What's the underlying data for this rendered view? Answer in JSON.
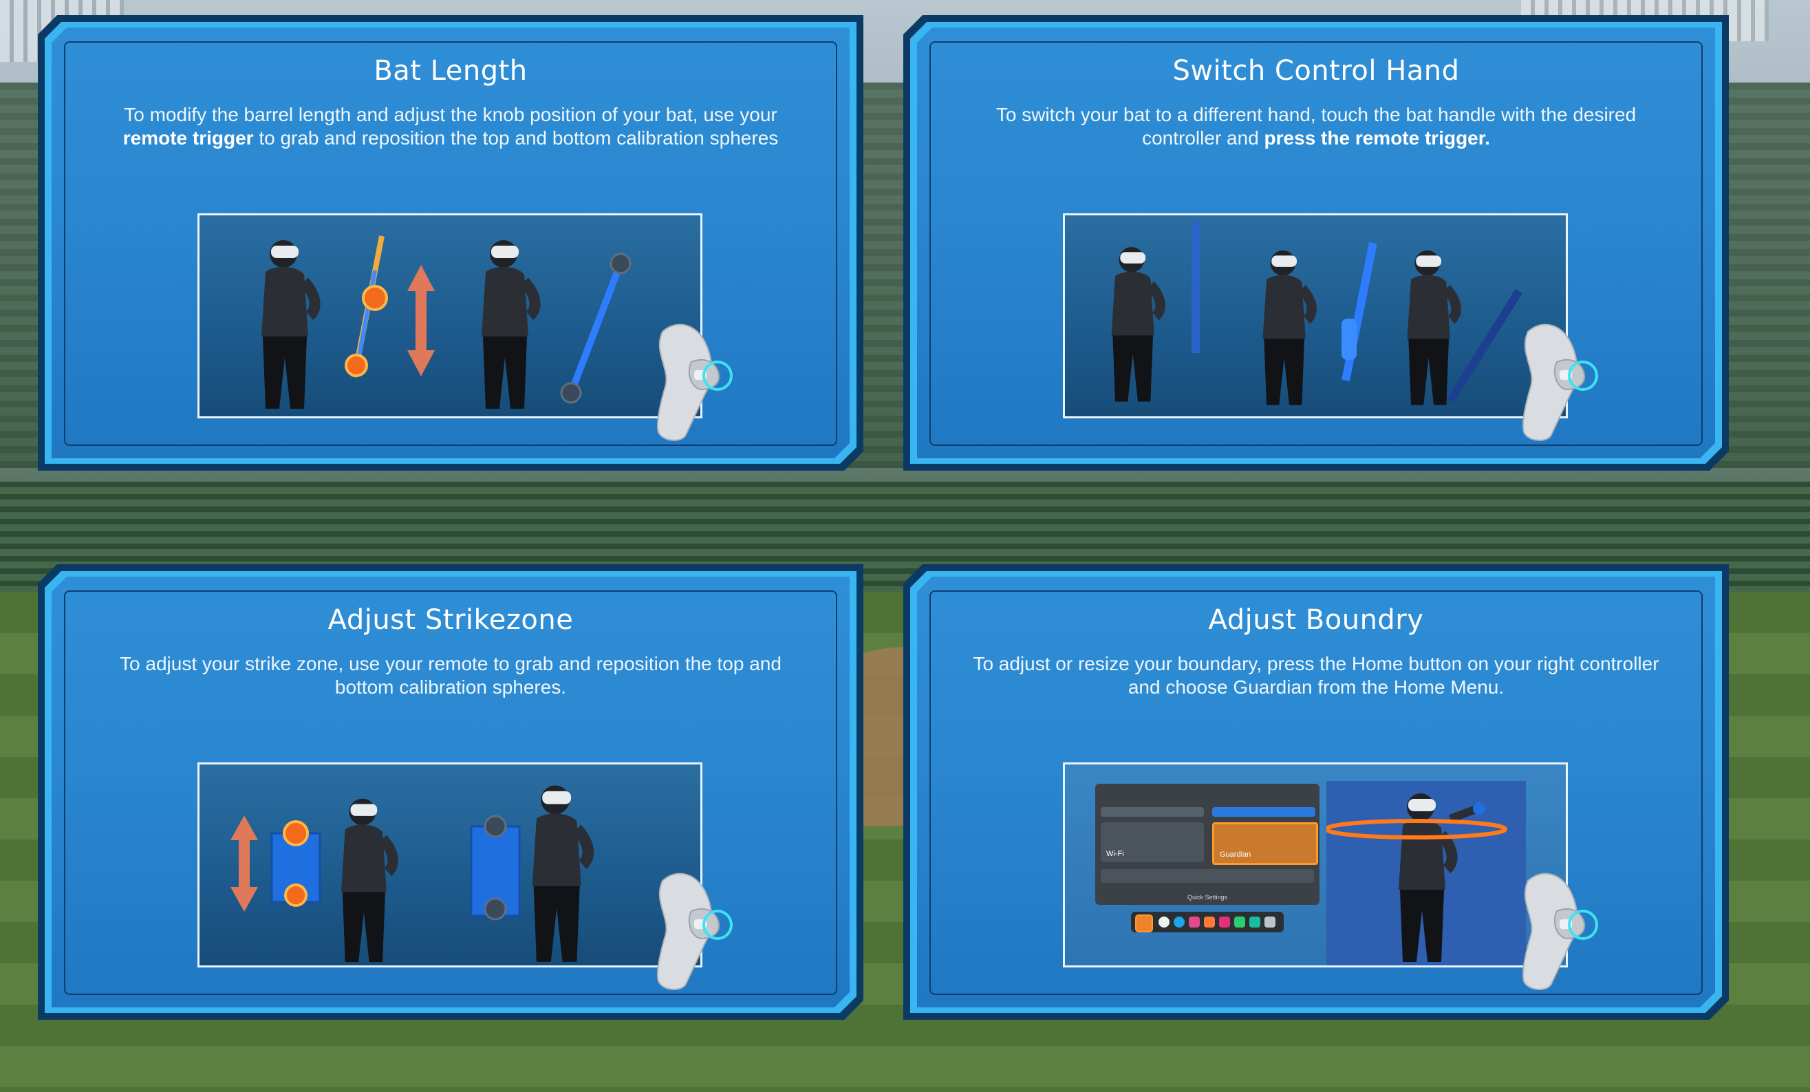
{
  "panels": [
    {
      "title": "Bat Length",
      "text_parts": [
        "To modify the barrel length and adjust the knob position of your bat, use your ",
        "remote trigger",
        " to grab and reposition the top and bottom calibration spheres"
      ]
    },
    {
      "title": "Switch Control Hand",
      "text_parts": [
        "To switch your bat to a different hand, touch the bat handle with the desired controller and ",
        "press the remote trigger.",
        ""
      ]
    },
    {
      "title": "Adjust Strikezone",
      "text_parts": [
        "To adjust your strike zone, use your remote to grab and reposition the top and bottom calibration spheres.",
        "",
        ""
      ]
    },
    {
      "title": "Adjust Boundry",
      "text_parts": [
        "To adjust or resize your boundary, press the Home button on your right controller and choose Guardian from the Home Menu.",
        "",
        ""
      ]
    }
  ],
  "quest_menu": {
    "wifi": "Wi-Fi",
    "guardian": "Guardian",
    "footer": "Quick Settings"
  },
  "colors": {
    "panel_blue": "#2a86cf",
    "panel_ring": "#39b6f2",
    "panel_border": "#0b3a64",
    "sphere_orange": "#f26a1b",
    "arrow_salmon": "#e0785a",
    "highlight_cyan": "#3fe3ef"
  },
  "icons": [
    "vr-controller-icon",
    "double-arrow-icon",
    "calibration-sphere-icon"
  ]
}
